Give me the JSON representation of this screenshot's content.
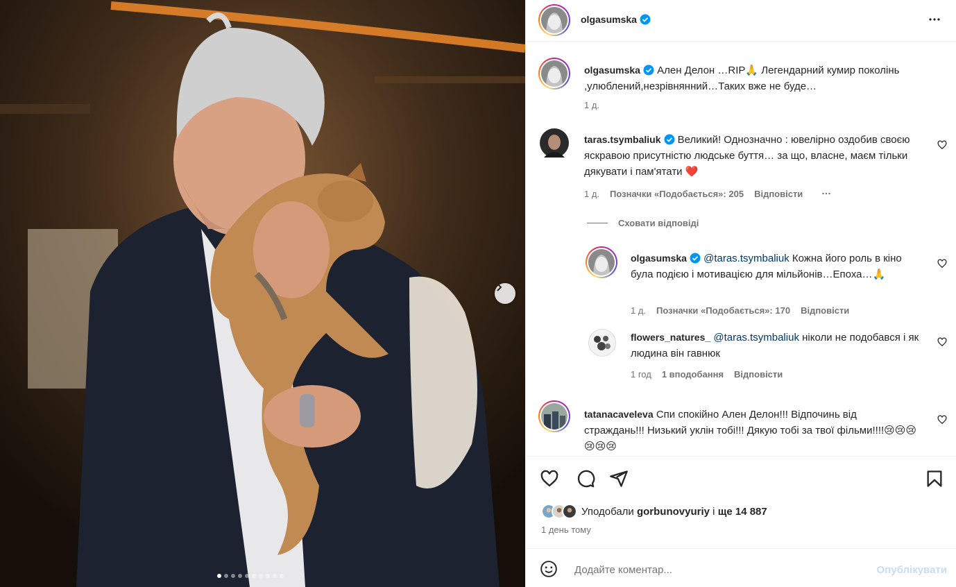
{
  "post": {
    "author": "olgasumska",
    "carousel": {
      "slide_count": 10,
      "active_index": 0
    }
  },
  "caption": {
    "username": "olgasumska",
    "text": "Ален Делон …RIP🙏 Легендарний кумир поколінь ,улюблений,незрівнянний…Таких вже не буде…",
    "time": "1 д."
  },
  "comments": [
    {
      "username": "taras.tsymbaliuk",
      "verified": true,
      "text": "Великий! Однозначно : ювелірно оздобив своєю яскравою присутністю людське буття… за що, власне, маєм тільки дякувати і пам'ятати ❤️",
      "time": "1 д.",
      "likes": "Позначки «Подобається»: 205",
      "reply": "Відповісти",
      "hide_replies": "Сховати відповіді",
      "replies": [
        {
          "username": "olgasumska",
          "verified": true,
          "mention": "@taras.tsymbaliuk",
          "text": "Кожна його роль в кіно була подією і мотивацією для мільйонів…Епоха…🙏",
          "time": "1 д.",
          "likes": "Позначки «Подобається»: 170",
          "reply": "Відповісти"
        },
        {
          "username": "flowers_natures_",
          "verified": false,
          "mention": "@taras.tsymbaliuk",
          "text": "ніколи не подобався і як людина він гавнюк",
          "time": "1 год",
          "likes": "1 вподобання",
          "reply": "Відповісти"
        }
      ]
    },
    {
      "username": "tatanacaveleva",
      "verified": false,
      "text": "Спи спокійно Ален Делон!!! Відпочинь від страждань!!! Низький уклін тобі!!! Дякую тобі за твої фільми!!!!😢😢😢😢😢😢"
    }
  ],
  "likes_summary": {
    "prefix": "Уподобали",
    "user": "gorbunovyuriy",
    "joiner": "і",
    "rest": "ще 14 887"
  },
  "post_date": "1 день тому",
  "add_comment": {
    "placeholder": "Додайте коментар...",
    "publish_label": "Опублікувати"
  },
  "colors": {
    "verified": "#0095f6",
    "heart_red": "#ed4956",
    "muted": "#737373",
    "publish_disabled": "#c7dcf5"
  }
}
